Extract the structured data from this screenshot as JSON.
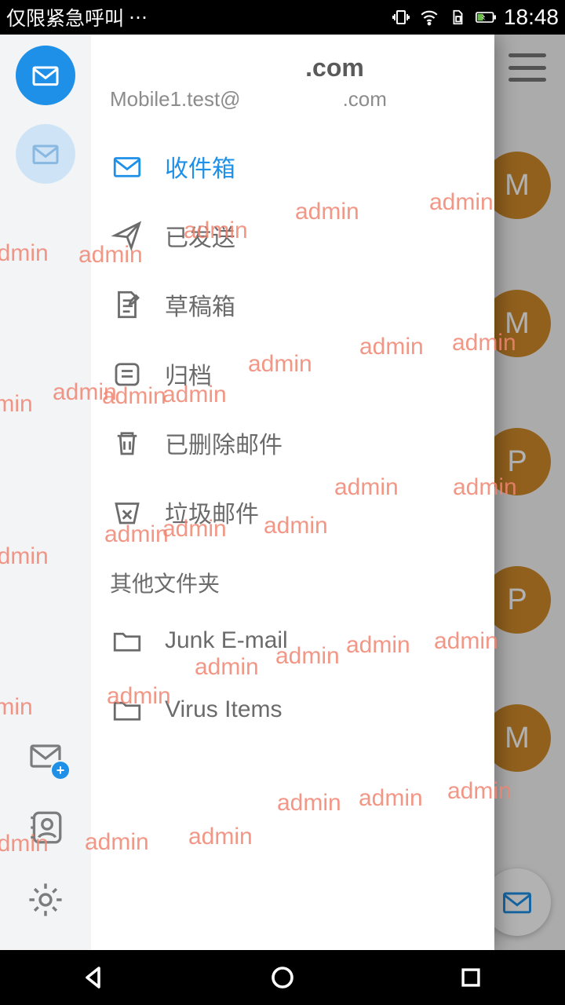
{
  "status": {
    "left_text": "仅限紧急呼叫",
    "time": "18:48"
  },
  "background": {
    "avatars": [
      "M",
      "M",
      "P",
      "P",
      "M"
    ]
  },
  "drawer": {
    "account": {
      "title_suffix": ".com",
      "email_prefix": "Mobile1.test@",
      "email_suffix": ".com"
    },
    "folders": [
      {
        "id": "inbox",
        "label": "收件箱",
        "active": true
      },
      {
        "id": "sent",
        "label": "已发送",
        "active": false
      },
      {
        "id": "drafts",
        "label": "草稿箱",
        "active": false
      },
      {
        "id": "archive",
        "label": "归档",
        "active": false
      },
      {
        "id": "deleted",
        "label": "已删除邮件",
        "active": false
      },
      {
        "id": "junk",
        "label": "垃圾邮件",
        "active": false
      }
    ],
    "other_section_title": "其他文件夹",
    "other_folders": [
      {
        "id": "junk-email",
        "label": "Junk E-mail"
      },
      {
        "id": "virus-items",
        "label": "Virus Items"
      }
    ]
  },
  "watermark": {
    "text": "admin",
    "positions": [
      [
        -20,
        262
      ],
      [
        100,
        264
      ],
      [
        234,
        233
      ],
      [
        376,
        209
      ],
      [
        547,
        197
      ],
      [
        -40,
        454
      ],
      [
        67,
        439
      ],
      [
        130,
        444
      ],
      [
        207,
        442
      ],
      [
        316,
        403
      ],
      [
        458,
        381
      ],
      [
        576,
        376
      ],
      [
        -20,
        648
      ],
      [
        133,
        620
      ],
      [
        207,
        613
      ],
      [
        336,
        609
      ],
      [
        426,
        560
      ],
      [
        577,
        560
      ],
      [
        -40,
        840
      ],
      [
        136,
        826
      ],
      [
        248,
        789
      ],
      [
        351,
        775
      ],
      [
        441,
        761
      ],
      [
        553,
        756
      ],
      [
        -20,
        1014
      ],
      [
        108,
        1012
      ],
      [
        240,
        1005
      ],
      [
        353,
        962
      ],
      [
        457,
        956
      ],
      [
        570,
        947
      ]
    ]
  }
}
